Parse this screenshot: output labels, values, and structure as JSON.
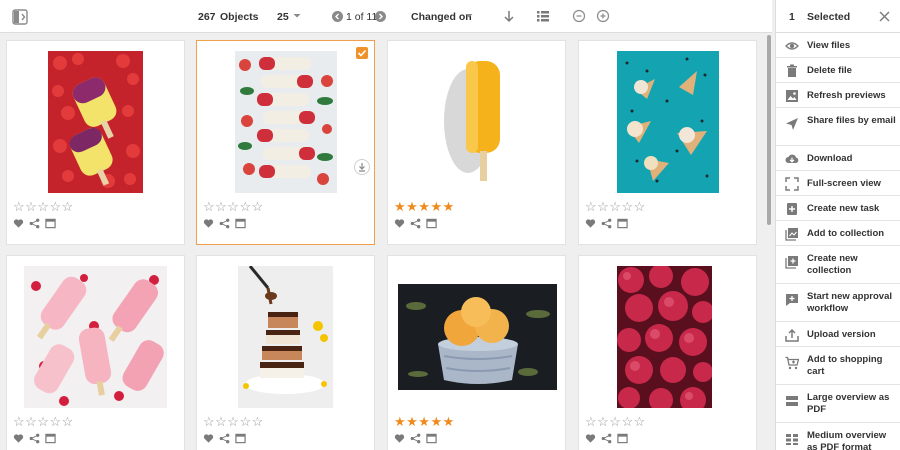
{
  "toolbar": {
    "object_count": "267",
    "objects_label": "Objects",
    "page_size": "25",
    "pagination": "1 of 11",
    "sort_label": "Changed on"
  },
  "selection": {
    "count": "1",
    "label": "Selected"
  },
  "cards": [
    {
      "name": "popsicles-strawberry-red",
      "rating": 0,
      "selected": false
    },
    {
      "name": "popsicles-strawberry-ice",
      "rating": 0,
      "selected": true
    },
    {
      "name": "popsicle-yellow",
      "rating": 5,
      "selected": false
    },
    {
      "name": "ice-cream-cones-teal",
      "rating": 0,
      "selected": false
    },
    {
      "name": "popsicles-pink-raspberry",
      "rating": 0,
      "selected": false
    },
    {
      "name": "chocolate-wafer-stack",
      "rating": 0,
      "selected": false
    },
    {
      "name": "ice-cream-bowl",
      "rating": 5,
      "selected": false
    },
    {
      "name": "raspberries-closeup",
      "rating": 0,
      "selected": false
    }
  ],
  "star_glyph_empty": "☆☆☆☆☆",
  "star_glyph_full": "★★★★★",
  "menu": [
    {
      "icon": "eye-icon",
      "label": "View files"
    },
    {
      "icon": "trash-icon",
      "label": "Delete file"
    },
    {
      "icon": "image-refresh-icon",
      "label": "Refresh previews"
    },
    {
      "icon": "paper-plane-icon",
      "label": "Share files by email"
    },
    {
      "icon": "cloud-download-icon",
      "label": "Download"
    },
    {
      "icon": "fullscreen-icon",
      "label": "Full-screen view"
    },
    {
      "icon": "task-plus-icon",
      "label": "Create new task"
    },
    {
      "icon": "collection-add-icon",
      "label": "Add to collection"
    },
    {
      "icon": "collection-new-icon",
      "label": "Create new collection"
    },
    {
      "icon": "workflow-plus-icon",
      "label": "Start new approval workflow"
    },
    {
      "icon": "upload-icon",
      "label": "Upload version"
    },
    {
      "icon": "cart-plus-icon",
      "label": "Add to shopping cart"
    },
    {
      "icon": "pdf-large-icon",
      "label": "Large overview as PDF"
    },
    {
      "icon": "pdf-medium-icon",
      "label": "Medium overview as PDF format"
    }
  ],
  "colors": {
    "accent": "#f0922b",
    "star_rated": "#f08a1c",
    "panel_bg": "#f7f7f7"
  }
}
